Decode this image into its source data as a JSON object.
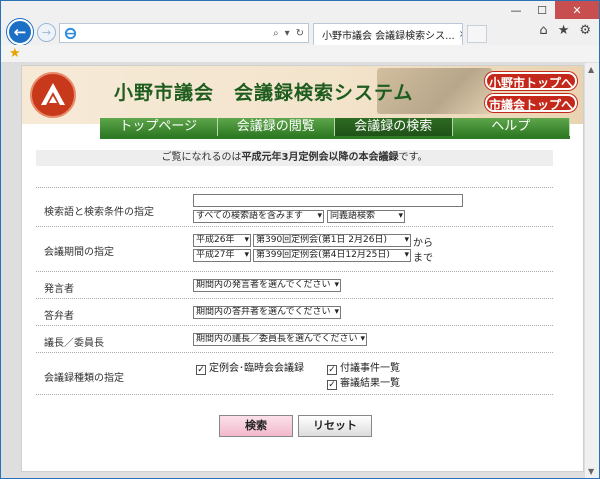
{
  "browser": {
    "tab_title": "小野市議会 会議録検索シス...",
    "tab_close": "×",
    "window_controls": {
      "minimize": "—",
      "maximize": "☐",
      "close": "✕"
    },
    "right_icons": [
      "home-icon",
      "star-icon",
      "gear-icon"
    ]
  },
  "site": {
    "title": "小野市議会　会議録検索システム",
    "links": {
      "city_top": "小野市トップへ",
      "council_top": "市議会トップへ"
    },
    "menu": [
      "トップページ",
      "会議録の閲覧",
      "会議録の検索",
      "ヘルプ"
    ],
    "active_menu": "会議録の検索",
    "notice_prefix": "ご覧になれるのは",
    "notice_bold": "平成元年3月定例会以降の本会議録",
    "notice_suffix": "です。"
  },
  "form": {
    "keyword": {
      "label": "検索語と検索条件の指定",
      "value": "",
      "condition": "すべての検索語を含みます",
      "mode": "同義語検索"
    },
    "period": {
      "label": "会議期間の指定",
      "from_year": "平成26年",
      "from_session": "第390回定例会(第1日 2月26日)",
      "from_suffix": "から",
      "to_year": "平成27年",
      "to_session": "第399回定例会(第4日12月25日)",
      "to_suffix": "まで"
    },
    "speaker": {
      "label": "発言者",
      "value": "期間内の発言者を選んでください"
    },
    "respondent": {
      "label": "答弁者",
      "value": "期間内の答弁者を選んでください"
    },
    "chair": {
      "label": "議長／委員長",
      "value": "期間内の議長／委員長を選んでください"
    },
    "types": {
      "label": "会議録種類の指定",
      "options": [
        {
          "label": "定例会･臨時会会議録",
          "checked": true
        },
        {
          "label": "付議事件一覧",
          "checked": true
        },
        {
          "label": "審議結果一覧",
          "checked": true
        }
      ]
    },
    "buttons": {
      "search": "検索",
      "reset": "リセット"
    }
  }
}
